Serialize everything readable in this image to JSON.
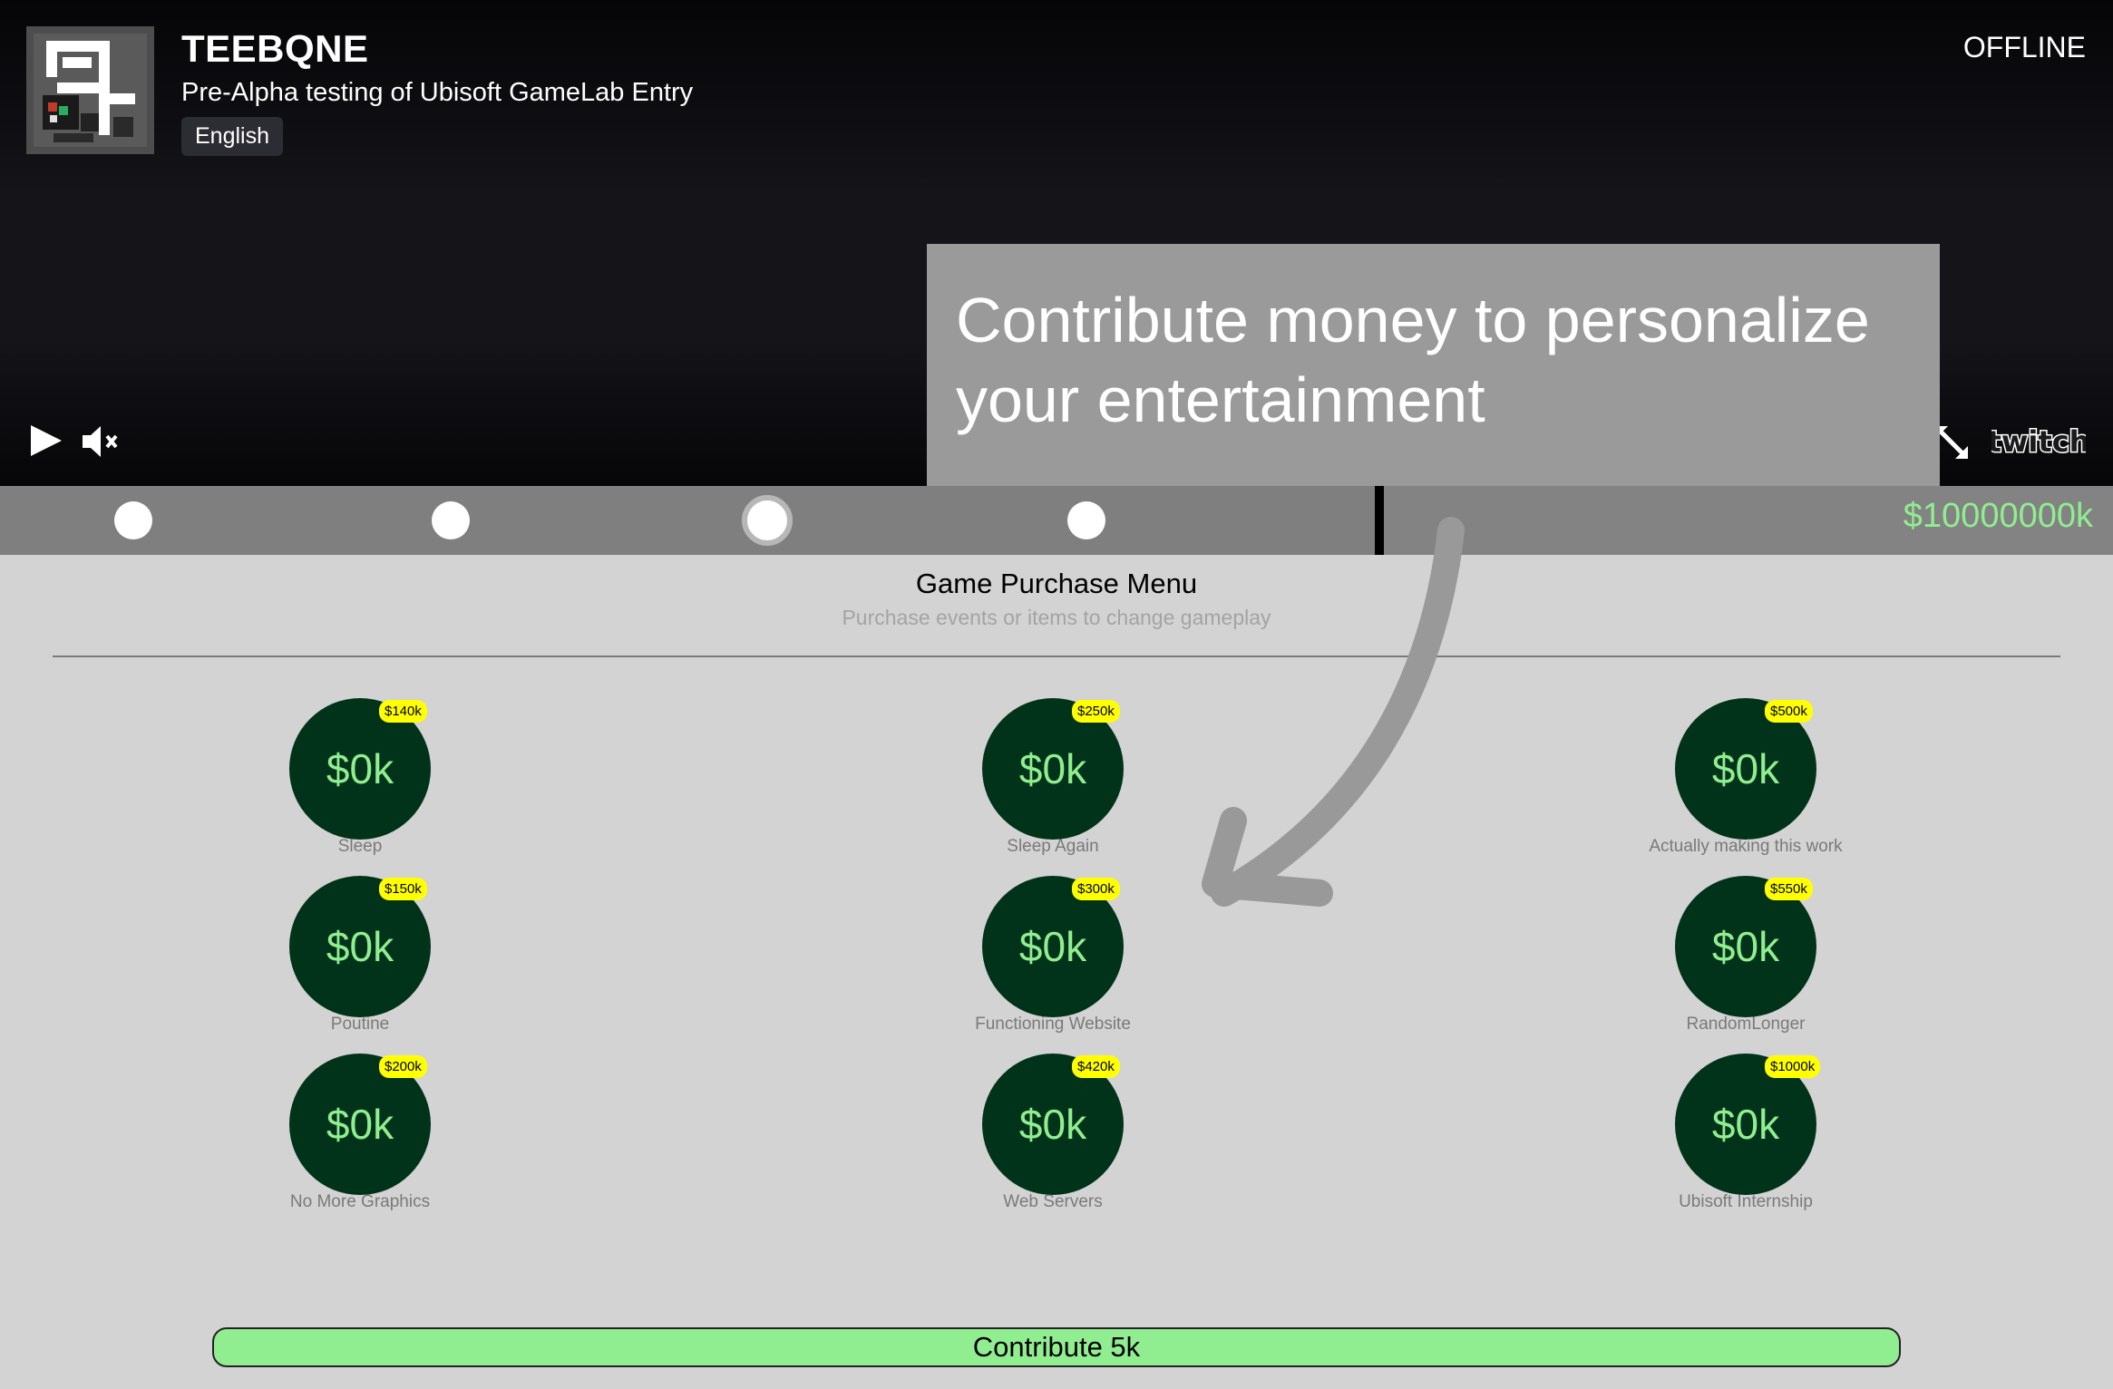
{
  "channel": {
    "name": "TEEBQNE",
    "stream_title": "Pre-Alpha testing of Ubisoft GameLab Entry",
    "language": "English",
    "status": "OFFLINE"
  },
  "player": {
    "controls": [
      "play-icon",
      "muted-speaker-icon",
      "fullscreen-icon",
      "twitch-logo"
    ]
  },
  "tooltip": {
    "text": "Contribute money to personalize your entertainment"
  },
  "timeline": {
    "dot_count": 4,
    "active_index": 2,
    "budget": "$10000000k"
  },
  "menu": {
    "title": "Game Purchase Menu",
    "subtitle": "Purchase events or items to change gameplay",
    "items": [
      {
        "amount": "$0k",
        "price": "$140k",
        "label": "Sleep"
      },
      {
        "amount": "$0k",
        "price": "$250k",
        "label": "Sleep Again"
      },
      {
        "amount": "$0k",
        "price": "$500k",
        "label": "Actually making this work"
      },
      {
        "amount": "$0k",
        "price": "$150k",
        "label": "Poutine"
      },
      {
        "amount": "$0k",
        "price": "$300k",
        "label": "Functioning Website"
      },
      {
        "amount": "$0k",
        "price": "$550k",
        "label": "RandomLonger"
      },
      {
        "amount": "$0k",
        "price": "$200k",
        "label": "No More Graphics"
      },
      {
        "amount": "$0k",
        "price": "$420k",
        "label": "Web Servers"
      },
      {
        "amount": "$0k",
        "price": "$1000k",
        "label": "Ubisoft Internship"
      }
    ]
  },
  "contribute": {
    "label": "Contribute 5k"
  },
  "colors": {
    "accent_green": "#90ee90",
    "circle_bg": "#00331a",
    "badge_yellow": "#ffff00"
  }
}
